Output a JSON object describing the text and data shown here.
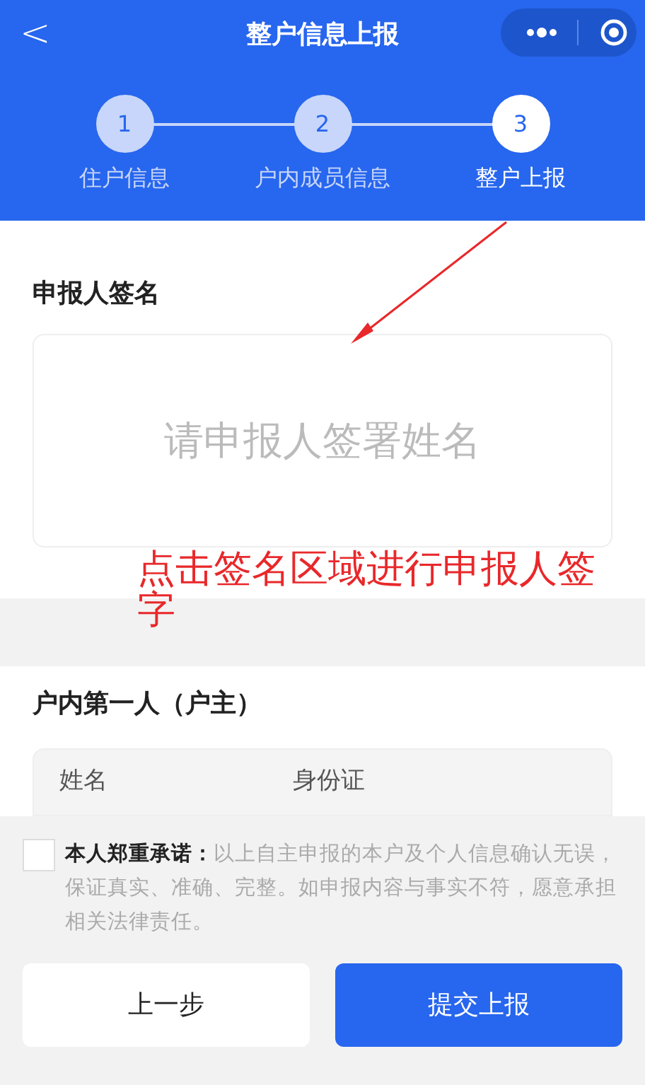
{
  "nav": {
    "back": "<",
    "title": "整户信息上报"
  },
  "steps": [
    {
      "number": "1",
      "label": "住户信息",
      "selected": false
    },
    {
      "number": "2",
      "label": "户内成员信息",
      "selected": false
    },
    {
      "number": "3",
      "label": "整户上报",
      "selected": true
    }
  ],
  "signature": {
    "title": "申报人签名",
    "placeholder": "请申报人签署姓名"
  },
  "annotation": {
    "text": "点击签名区域进行申报人签字"
  },
  "member": {
    "title": "户内第一人（户主）",
    "columns": [
      "姓名",
      "身份证"
    ]
  },
  "pledge": {
    "checked": false,
    "text": "**本人郑重承诺：**以上自主申报的本户及个人信息确认无误，保证真实、准确、完整。如申报内容与事实不符，愿意承担相关法律责任。"
  },
  "buttons": [
    {
      "label": "上一步",
      "kind": "secondary"
    },
    {
      "label": "提交上报",
      "kind": "primary"
    }
  ]
}
